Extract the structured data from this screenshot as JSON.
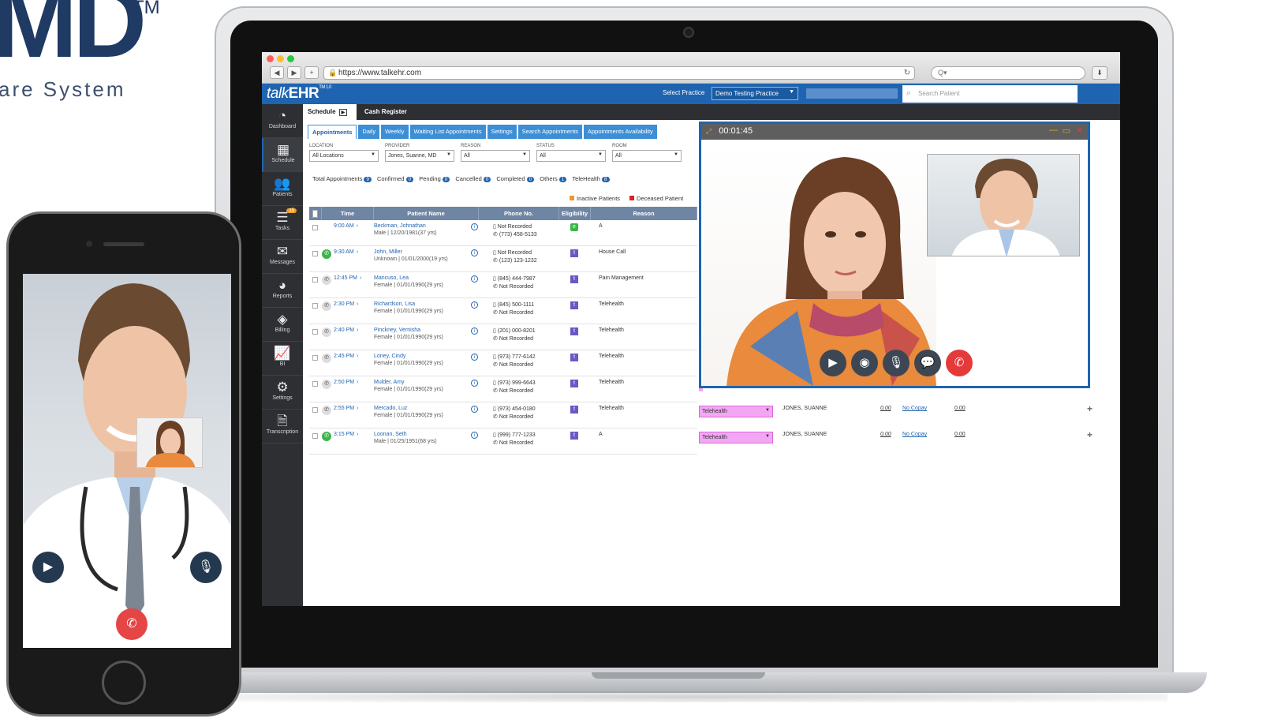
{
  "brand": {
    "logo": "MD",
    "tm": "TM",
    "tagline": "are System"
  },
  "browser": {
    "url": "https://www.talkehr.com",
    "search_placeholder": "Q▾"
  },
  "app": {
    "logo_light": "talk",
    "logo_bold": "EHR",
    "logo_version": "TM 1.0",
    "select_practice_label": "Select Practice",
    "practice_value": "Demo Testing Practice",
    "search_patient_placeholder": "Search Patient"
  },
  "sidebar": {
    "items": [
      {
        "label": "Dashboard",
        "icon": "dashboard-icon"
      },
      {
        "label": "Schedule",
        "icon": "calendar-icon"
      },
      {
        "label": "Patients",
        "icon": "patients-icon"
      },
      {
        "label": "Tasks",
        "icon": "tasks-icon",
        "badge": "15"
      },
      {
        "label": "Messages",
        "icon": "envelope-icon"
      },
      {
        "label": "Reports",
        "icon": "pie-chart-icon"
      },
      {
        "label": "Billing",
        "icon": "billing-icon"
      },
      {
        "label": "BI",
        "icon": "line-chart-icon"
      },
      {
        "label": "Settings",
        "icon": "gear-icon"
      },
      {
        "label": "Transcription",
        "icon": "transcription-icon"
      }
    ]
  },
  "main_tabs": {
    "schedule": "Schedule",
    "cash_register": "Cash Register"
  },
  "subtabs": [
    "Appointments",
    "Daily",
    "Weekly",
    "Waiting List Appointments",
    "Settings",
    "Search Appointments",
    "Appointments Availability"
  ],
  "filters": {
    "location": {
      "label": "LOCATION",
      "value": "All Locations"
    },
    "provider": {
      "label": "PROVIDER",
      "value": "Jones, Suanne, MD"
    },
    "reason": {
      "label": "REASON",
      "value": "All"
    },
    "status": {
      "label": "STATUS",
      "value": "All"
    },
    "room": {
      "label": "ROOM",
      "value": "All"
    }
  },
  "summary": [
    {
      "label": "Total Appointments",
      "count": "9"
    },
    {
      "label": "Confirmed",
      "count": "0"
    },
    {
      "label": "Pending",
      "count": "0"
    },
    {
      "label": "Cancelled",
      "count": "0"
    },
    {
      "label": "Completed",
      "count": "0"
    },
    {
      "label": "Others",
      "count": "1"
    },
    {
      "label": "TeleHealth",
      "count": "8"
    }
  ],
  "legend": {
    "inactive": "Inactive Patients",
    "deceased": "Deceased Patient",
    "inactive_color": "#f0962c",
    "deceased_color": "#e02020"
  },
  "table": {
    "headers": [
      "Time",
      "Patient Name",
      "Phone No.",
      "Eligibility",
      "Reason"
    ],
    "rows": [
      {
        "time": "9:00 AM",
        "name": "Beckman, Johnathan",
        "sub": "Male | 12/20/1981(37 yrs)",
        "phone1": "Not Recorded",
        "phone2": "(773) 458-5133",
        "elig": "e",
        "reason": "A"
      },
      {
        "time": "9:30 AM",
        "name": "John, Miller",
        "sub": "Unknown | 01/01/2000(19 yrs)",
        "phone1": "Not Recorded",
        "phone2": "(123) 123-1232",
        "elig": "t",
        "reason": "House Call"
      },
      {
        "time": "12:45 PM",
        "name": "Mancuso, Lea",
        "sub": "Female | 01/01/1990(29 yrs)",
        "phone1": "(845) 444-7987",
        "phone2": "Not Recorded",
        "elig": "t",
        "reason": "Pain Management"
      },
      {
        "time": "2:30 PM",
        "name": "Richardson, Lisa",
        "sub": "Female | 01/01/1990(29 yrs)",
        "phone1": "(845) 500-1111",
        "phone2": "Not Recorded",
        "elig": "t",
        "reason": "Telehealth"
      },
      {
        "time": "2:40 PM",
        "name": "Pinckney, Vernisha",
        "sub": "Female | 01/01/1990(29 yrs)",
        "phone1": "(201) 000-8201",
        "phone2": "Not Recorded",
        "elig": "t",
        "reason": "Telehealth"
      },
      {
        "time": "2:45 PM",
        "name": "Loney, Cindy",
        "sub": "Female | 01/01/1990(29 yrs)",
        "phone1": "(973) 777-6142",
        "phone2": "Not Recorded",
        "elig": "t",
        "reason": "Telehealth"
      },
      {
        "time": "2:50 PM",
        "name": "Mulder, Amy",
        "sub": "Female | 01/01/1990(29 yrs)",
        "phone1": "(973) 999-6643",
        "phone2": "Not Recorded",
        "elig": "t",
        "reason": "Telehealth"
      },
      {
        "time": "2:55 PM",
        "name": "Mercado, Luz",
        "sub": "Female | 01/01/1990(29 yrs)",
        "phone1": "(973) 454-0180",
        "phone2": "Not Recorded",
        "elig": "t",
        "reason": "Telehealth"
      },
      {
        "time": "3:15 PM",
        "name": "Loonan, Seth",
        "sub": "Male | 01/25/1951(68 yrs)",
        "phone1": "(999) 777-1233",
        "phone2": "Not Recorded",
        "elig": "t",
        "reason": "A"
      }
    ],
    "extra": [
      {
        "visit": "Telehealth",
        "provider": "JONES, SUANNE",
        "amount": "0.00",
        "copay": "No Copay",
        "balance": "0.00"
      },
      {
        "visit": "Telehealth",
        "provider": "JONES, SUANNE",
        "amount": "0.00",
        "copay": "No Copay",
        "balance": "0.00"
      }
    ]
  },
  "video": {
    "timer": "00:01:45"
  }
}
